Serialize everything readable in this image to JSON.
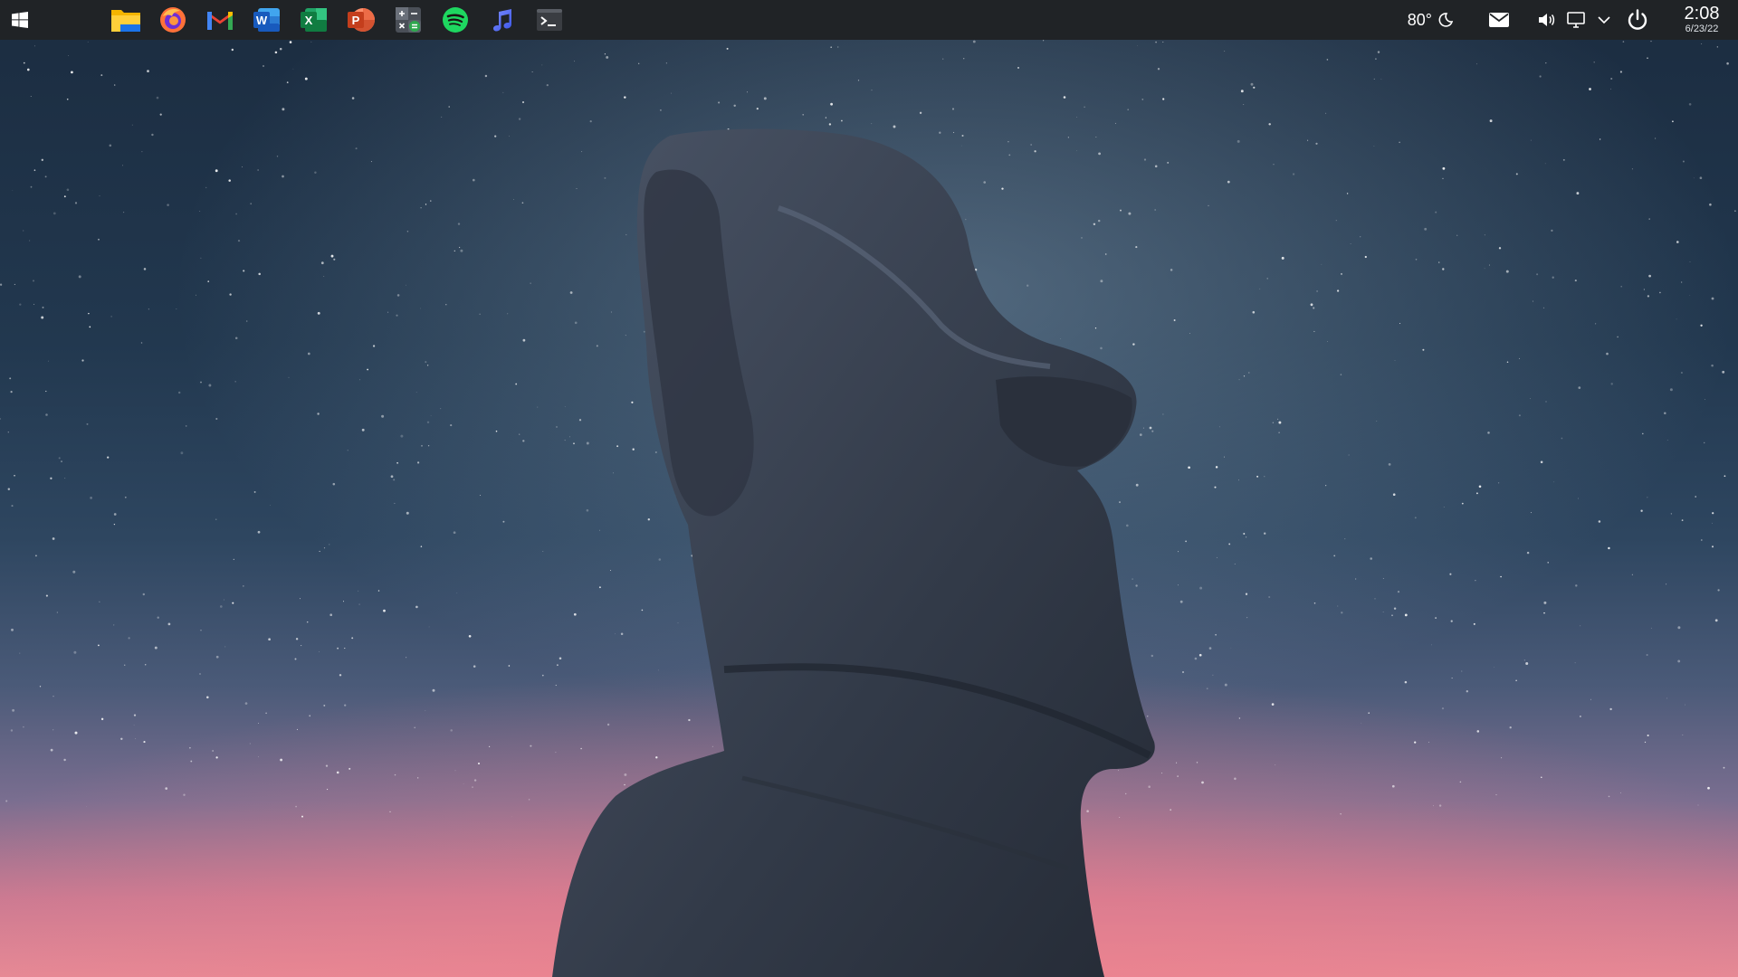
{
  "taskbar": {
    "start_icon": "windows-logo-icon",
    "pinned_apps": [
      {
        "name": "File Explorer",
        "icon": "folder-icon"
      },
      {
        "name": "Firefox",
        "icon": "firefox-icon"
      },
      {
        "name": "Gmail",
        "icon": "gmail-icon"
      },
      {
        "name": "Word",
        "icon": "word-icon",
        "letter": "W"
      },
      {
        "name": "Excel",
        "icon": "excel-icon",
        "letter": "X"
      },
      {
        "name": "PowerPoint",
        "icon": "powerpoint-icon",
        "letter": "P"
      },
      {
        "name": "Calculator",
        "icon": "calculator-icon"
      },
      {
        "name": "Spotify",
        "icon": "spotify-icon"
      },
      {
        "name": "Music",
        "icon": "music-note-icon"
      },
      {
        "name": "Terminal",
        "icon": "terminal-icon"
      }
    ]
  },
  "tray": {
    "weather": "80°",
    "weather_icon": "moon-icon",
    "icons": [
      "mail-icon",
      "volume-icon",
      "network-monitor-icon",
      "chevron-down-icon",
      "power-icon"
    ]
  },
  "clock": {
    "time": "2:08",
    "date": "6/23/22"
  },
  "wallpaper": {
    "subject": "moai-statue-icon",
    "colors": {
      "sky_top": "#1b2c40",
      "sky_glow": "#e58a96",
      "stone": "#3a4250"
    }
  },
  "colors": {
    "taskbar_bg": "#202326",
    "taskbar_text": "#ffffff"
  }
}
